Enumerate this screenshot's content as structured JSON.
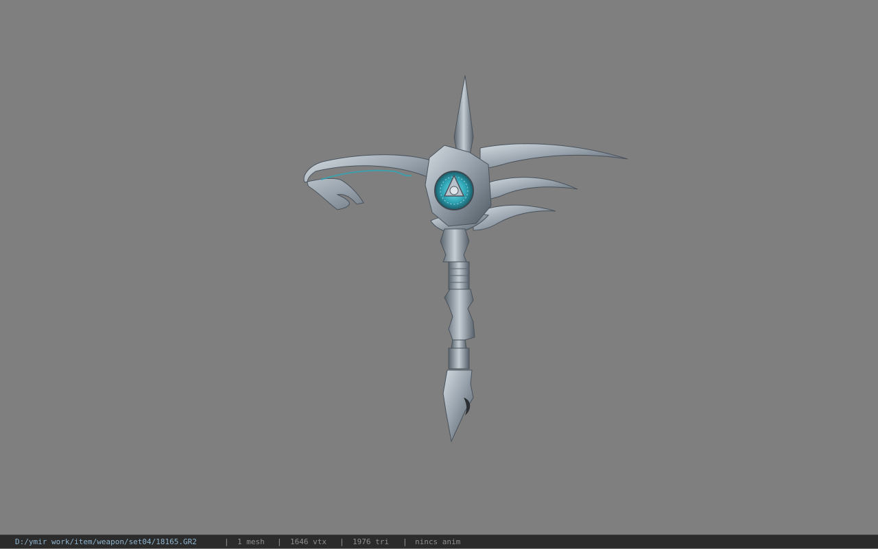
{
  "status_bar": {
    "file_path": "D:/ymir work/item/weapon/set04/18165.GR2",
    "separator": "|",
    "mesh_count": "1 mesh",
    "vertex_count": "1646 vtx",
    "triangle_count": "1976 tri",
    "animation": "nincs anim"
  },
  "colors": {
    "viewport_background": "#7f7f7f",
    "status_bar_background": "#2b2b2b",
    "path_text": "#8fb5cf",
    "stats_text": "#8f8f8f",
    "metal": "#9aa4ae",
    "rune_glow": "#2fa7b7"
  }
}
